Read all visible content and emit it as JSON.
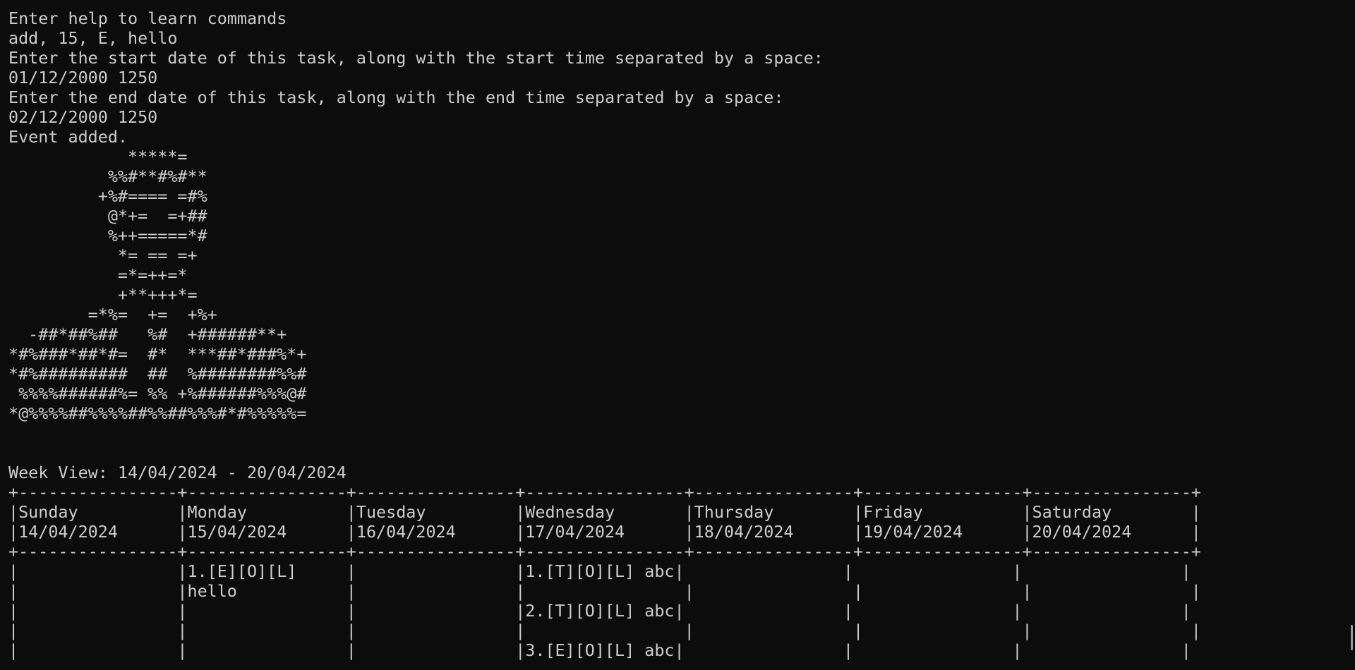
{
  "terminal": {
    "lines": [
      "Enter help to learn commands",
      "add, 15, E, hello",
      "Enter the start date of this task, along with the start time separated by a space:",
      "01/12/2000 1250",
      "Enter the end date of this task, along with the end time separated by a space:",
      "02/12/2000 1250",
      "Event added.",
      "            *****=",
      "          %%#**#%#**",
      "         +%#==== =#%",
      "          @*+=  =+##",
      "          %++=====*#",
      "           *= == =+",
      "           =*=++=*",
      "           +**+++*=",
      "        =*%=  +=  +%+",
      "  -##*##%##   %#  +######**+",
      "*#%###*##*#=  #*  ***##*###%*+",
      "*#%#########  ##  %########%%#",
      " %%%%######%= %% +%######%%%@#",
      "*@%%%%##%%%%##%%##%%%#*#%%%%%=",
      "",
      "",
      "Week View: 14/04/2024 - 20/04/2024",
      "+----------------+----------------+----------------+----------------+----------------+----------------+----------------+",
      "|Sunday          |Monday          |Tuesday         |Wednesday       |Thursday        |Friday          |Saturday        |",
      "|14/04/2024      |15/04/2024      |16/04/2024      |17/04/2024      |18/04/2024      |19/04/2024      |20/04/2024      |",
      "+----------------+----------------+----------------+----------------+----------------+----------------+----------------+",
      "|                |1.[E][O][L]     |                |1.[T][O][L] abc|                |                |                |",
      "|                |hello           |                |                |                |                |                |",
      "|                |                |                |2.[T][O][L] abc|                |                |                |",
      "|                |                |                |                |                |                |                |",
      "|                |                |                |3.[E][O][L] abc|                |                |                |"
    ]
  },
  "colors": {
    "background": "#0c0c0c",
    "text": "#cccccc",
    "scrollbar": "#9a9a9a"
  }
}
